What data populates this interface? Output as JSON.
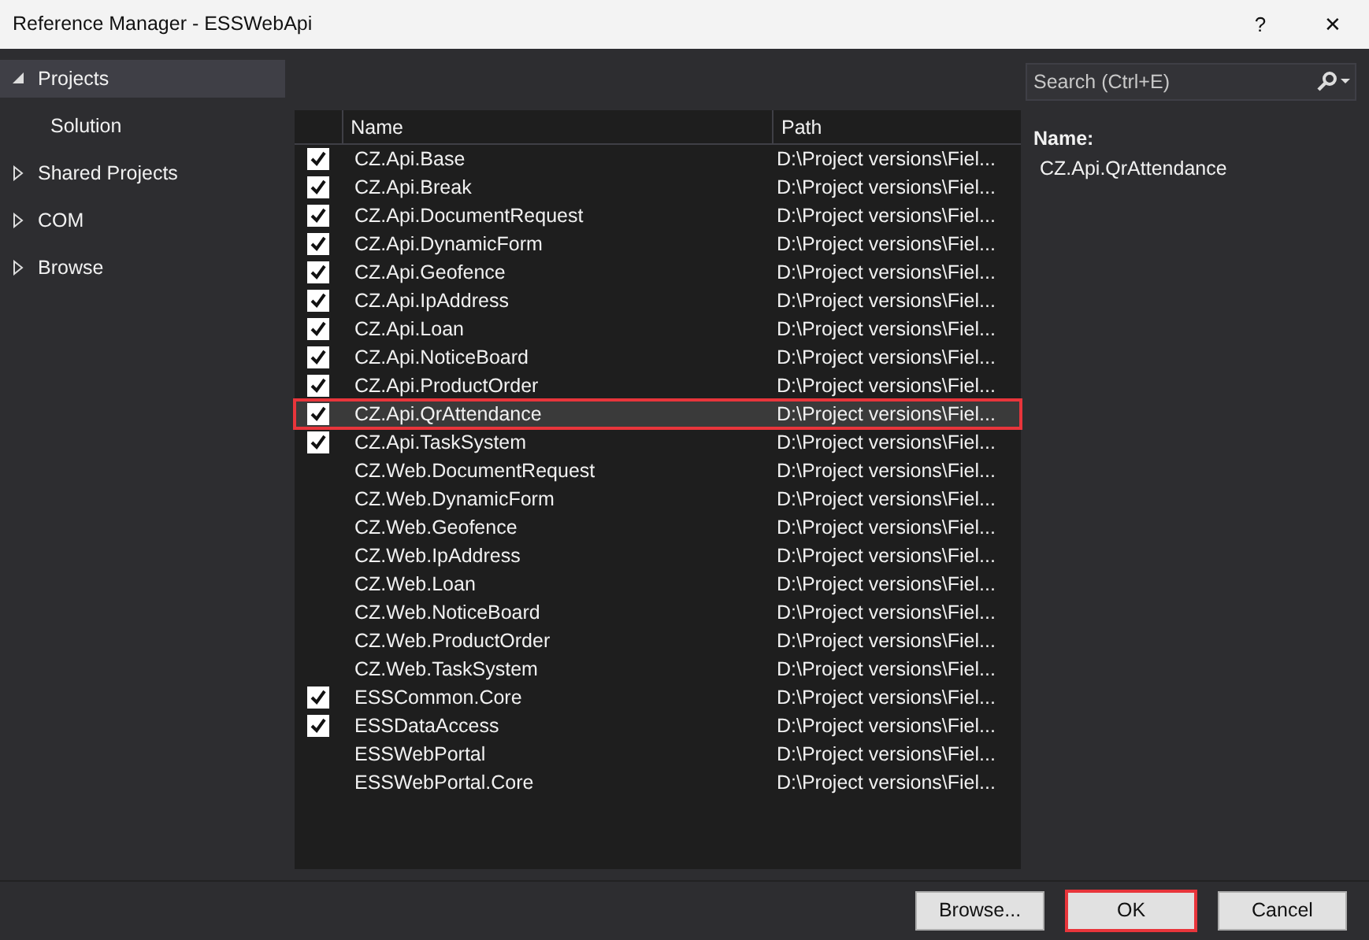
{
  "window": {
    "title": "Reference Manager - ESSWebApi",
    "buttons": [
      "?",
      "✕"
    ]
  },
  "sidebar": {
    "items": [
      {
        "label": "Projects",
        "expanded": true,
        "selected": true,
        "children": [
          {
            "label": "Solution",
            "selected": false
          }
        ]
      },
      {
        "label": "Shared Projects",
        "expanded": false,
        "selected": false
      },
      {
        "label": "COM",
        "expanded": false,
        "selected": false
      },
      {
        "label": "Browse",
        "expanded": false,
        "selected": false
      }
    ]
  },
  "search": {
    "placeholder": "Search (Ctrl+E)"
  },
  "table": {
    "columns": [
      "Name",
      "Path"
    ],
    "rows": [
      {
        "checked": true,
        "name": "CZ.Api.Base",
        "path": "D:\\Project versions\\Fiel...",
        "selected": false,
        "annotated": false
      },
      {
        "checked": true,
        "name": "CZ.Api.Break",
        "path": "D:\\Project versions\\Fiel...",
        "selected": false,
        "annotated": false
      },
      {
        "checked": true,
        "name": "CZ.Api.DocumentRequest",
        "path": "D:\\Project versions\\Fiel...",
        "selected": false,
        "annotated": false
      },
      {
        "checked": true,
        "name": "CZ.Api.DynamicForm",
        "path": "D:\\Project versions\\Fiel...",
        "selected": false,
        "annotated": false
      },
      {
        "checked": true,
        "name": "CZ.Api.Geofence",
        "path": "D:\\Project versions\\Fiel...",
        "selected": false,
        "annotated": false
      },
      {
        "checked": true,
        "name": "CZ.Api.IpAddress",
        "path": "D:\\Project versions\\Fiel...",
        "selected": false,
        "annotated": false
      },
      {
        "checked": true,
        "name": "CZ.Api.Loan",
        "path": "D:\\Project versions\\Fiel...",
        "selected": false,
        "annotated": false
      },
      {
        "checked": true,
        "name": "CZ.Api.NoticeBoard",
        "path": "D:\\Project versions\\Fiel...",
        "selected": false,
        "annotated": false
      },
      {
        "checked": true,
        "name": "CZ.Api.ProductOrder",
        "path": "D:\\Project versions\\Fiel...",
        "selected": false,
        "annotated": false
      },
      {
        "checked": true,
        "name": "CZ.Api.QrAttendance",
        "path": "D:\\Project versions\\Fiel...",
        "selected": true,
        "annotated": true
      },
      {
        "checked": true,
        "name": "CZ.Api.TaskSystem",
        "path": "D:\\Project versions\\Fiel...",
        "selected": false,
        "annotated": false
      },
      {
        "checked": false,
        "name": "CZ.Web.DocumentRequest",
        "path": "D:\\Project versions\\Fiel...",
        "selected": false,
        "annotated": false
      },
      {
        "checked": false,
        "name": "CZ.Web.DynamicForm",
        "path": "D:\\Project versions\\Fiel...",
        "selected": false,
        "annotated": false
      },
      {
        "checked": false,
        "name": "CZ.Web.Geofence",
        "path": "D:\\Project versions\\Fiel...",
        "selected": false,
        "annotated": false
      },
      {
        "checked": false,
        "name": "CZ.Web.IpAddress",
        "path": "D:\\Project versions\\Fiel...",
        "selected": false,
        "annotated": false
      },
      {
        "checked": false,
        "name": "CZ.Web.Loan",
        "path": "D:\\Project versions\\Fiel...",
        "selected": false,
        "annotated": false
      },
      {
        "checked": false,
        "name": "CZ.Web.NoticeBoard",
        "path": "D:\\Project versions\\Fiel...",
        "selected": false,
        "annotated": false
      },
      {
        "checked": false,
        "name": "CZ.Web.ProductOrder",
        "path": "D:\\Project versions\\Fiel...",
        "selected": false,
        "annotated": false
      },
      {
        "checked": false,
        "name": "CZ.Web.TaskSystem",
        "path": "D:\\Project versions\\Fiel...",
        "selected": false,
        "annotated": false
      },
      {
        "checked": true,
        "name": "ESSCommon.Core",
        "path": "D:\\Project versions\\Fiel...",
        "selected": false,
        "annotated": false
      },
      {
        "checked": true,
        "name": "ESSDataAccess",
        "path": "D:\\Project versions\\Fiel...",
        "selected": false,
        "annotated": false
      },
      {
        "checked": false,
        "name": "ESSWebPortal",
        "path": "D:\\Project versions\\Fiel...",
        "selected": false,
        "annotated": false
      },
      {
        "checked": false,
        "name": "ESSWebPortal.Core",
        "path": "D:\\Project versions\\Fiel...",
        "selected": false,
        "annotated": false
      }
    ]
  },
  "details": {
    "label": "Name:",
    "value": "CZ.Api.QrAttendance"
  },
  "footer_buttons": [
    {
      "label": "Browse...",
      "annotated": false
    },
    {
      "label": "OK",
      "annotated": true
    },
    {
      "label": "Cancel",
      "annotated": false
    }
  ]
}
